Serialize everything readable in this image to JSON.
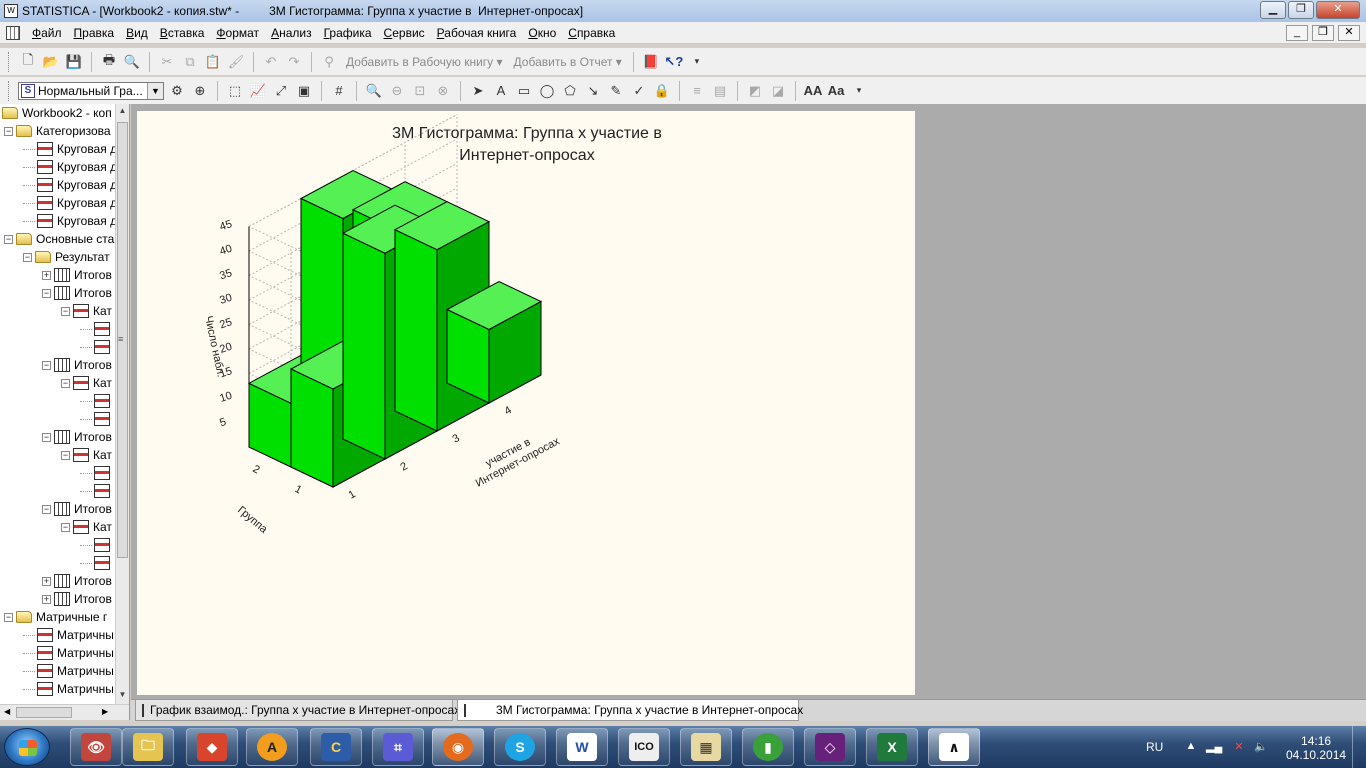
{
  "window": {
    "title": "STATISTICA - [Workbook2 - копия.stw* -         3М Гистограмма: Группа х участие в  Интернет-опросах]",
    "min": "▁",
    "max": "❐",
    "close": "✕"
  },
  "menu": [
    "Файл",
    "Правка",
    "Вид",
    "Вставка",
    "Формат",
    "Анализ",
    "Графика",
    "Сервис",
    "Рабочая книга",
    "Окно",
    "Справка"
  ],
  "mdi": {
    "min": "_",
    "restore": "❐",
    "close": "✕"
  },
  "toolbar1": {
    "add_workbook": "Добавить в Рабочую книгу ▾",
    "add_report": "Добавить в Отчет ▾"
  },
  "toolbar2": {
    "graph_type": "Нормальный Гра..."
  },
  "tree": {
    "root": "Workbook2 - коп",
    "items": [
      {
        "level": 0,
        "type": "folder",
        "exp": "−",
        "label": "Категоризова"
      },
      {
        "level": 1,
        "type": "graph",
        "label": "Круговая д"
      },
      {
        "level": 1,
        "type": "graph",
        "label": "Круговая д"
      },
      {
        "level": 1,
        "type": "graph",
        "label": "Круговая д"
      },
      {
        "level": 1,
        "type": "graph",
        "label": "Круговая д"
      },
      {
        "level": 1,
        "type": "graph",
        "label": "Круговая д"
      },
      {
        "level": 0,
        "type": "folder",
        "exp": "−",
        "label": "Основные ста"
      },
      {
        "level": 1,
        "type": "folder",
        "exp": "−",
        "label": "Результат"
      },
      {
        "level": 2,
        "type": "table",
        "exp": "+",
        "label": "Итогов"
      },
      {
        "level": 2,
        "type": "table",
        "exp": "−",
        "label": "Итогов"
      },
      {
        "level": 3,
        "type": "graph",
        "exp": "−",
        "label": "Кат"
      },
      {
        "level": 4,
        "type": "graph",
        "label": ""
      },
      {
        "level": 4,
        "type": "graph",
        "label": ""
      },
      {
        "level": 2,
        "type": "table",
        "exp": "−",
        "label": "Итогов"
      },
      {
        "level": 3,
        "type": "graph",
        "exp": "−",
        "label": "Кат"
      },
      {
        "level": 4,
        "type": "graph",
        "label": ""
      },
      {
        "level": 4,
        "type": "graph",
        "label": ""
      },
      {
        "level": 2,
        "type": "table",
        "exp": "−",
        "label": "Итогов"
      },
      {
        "level": 3,
        "type": "graph",
        "exp": "−",
        "label": "Кат"
      },
      {
        "level": 4,
        "type": "graph",
        "label": ""
      },
      {
        "level": 4,
        "type": "graph",
        "label": ""
      },
      {
        "level": 2,
        "type": "table",
        "exp": "−",
        "label": "Итогов"
      },
      {
        "level": 3,
        "type": "graph",
        "exp": "−",
        "label": "Кат"
      },
      {
        "level": 4,
        "type": "graph",
        "label": ""
      },
      {
        "level": 4,
        "type": "graph",
        "label": ""
      },
      {
        "level": 2,
        "type": "table",
        "exp": "+",
        "label": "Итогов"
      },
      {
        "level": 2,
        "type": "table",
        "exp": "+",
        "label": "Итогов"
      },
      {
        "level": 0,
        "type": "folder",
        "exp": "−",
        "label": "Матричные г"
      },
      {
        "level": 1,
        "type": "graph",
        "label": "Матричны"
      },
      {
        "level": 1,
        "type": "graph",
        "label": "Матричны"
      },
      {
        "level": 1,
        "type": "graph",
        "label": "Матричны"
      },
      {
        "level": 1,
        "type": "graph",
        "label": "Матричны"
      }
    ]
  },
  "tabs": [
    {
      "label": "График  взаимод.: Группа х участие в  Интернет-опросах"
    },
    {
      "label": "3М Гистограмма: Группа х участие в  Интернет-опросах"
    }
  ],
  "colors": {
    "bar_top": "#54f054",
    "bar_front": "#00e000",
    "bar_side": "#00a800",
    "canvas": "#fffbf0"
  },
  "chart_data": {
    "type": "bar3d",
    "title": "3М Гистограмма: Группа х участие в\nИнтернет-опросах",
    "title_lines": [
      "3М Гистограмма: Группа х участие в",
      "Интернет-опросах"
    ],
    "xlabel": "участие в Интернет-опросах",
    "xlabel_lines": [
      "участие в",
      "Интернет-опросах"
    ],
    "ylabel": "Группа",
    "zlabel": "Число набл.",
    "x_categories": [
      "1",
      "2",
      "3",
      "4"
    ],
    "y_categories": [
      "1",
      "2"
    ],
    "z_ticks": [
      5,
      10,
      15,
      20,
      25,
      30,
      35,
      40,
      45
    ],
    "zlim": [
      0,
      45
    ],
    "bars": [
      {
        "x": "1",
        "y": "2",
        "value": 13
      },
      {
        "x": "2",
        "y": "2",
        "value": 45
      },
      {
        "x": "3",
        "y": "2",
        "value": 37
      },
      {
        "x": "4",
        "y": "2",
        "value": 13
      },
      {
        "x": "1",
        "y": "1",
        "value": 20
      },
      {
        "x": "2",
        "y": "1",
        "value": 42
      },
      {
        "x": "3",
        "y": "1",
        "value": 37
      },
      {
        "x": "4",
        "y": "1",
        "value": 15
      }
    ]
  },
  "taskbar": {
    "apps": [
      "eye-icon",
      "explorer-icon",
      "sketchup-icon",
      "avast-icon",
      "cpp-builder-icon",
      "circuit-icon",
      "firefox-icon",
      "skype-icon",
      "word-icon",
      "ico-editor-icon",
      "nero-icon",
      "stat-icon",
      "visual-studio-icon",
      "excel-icon",
      "statistica-icon"
    ],
    "ico_label": "ICO",
    "word_label": "W",
    "excel_label": "X",
    "lang": "RU",
    "time": "14:16",
    "date": "04.10.2014"
  }
}
